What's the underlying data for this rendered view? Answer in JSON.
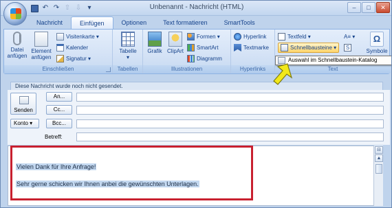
{
  "window": {
    "title": "Unbenannt - Nachricht (HTML)",
    "controls": [
      "–",
      "□",
      "✕"
    ]
  },
  "quick_access": {
    "undo": "↶",
    "redo": "↷",
    "up": "⇧",
    "down": "⇩",
    "customize": "▾"
  },
  "tabs": [
    {
      "label": "Nachricht",
      "active": false
    },
    {
      "label": "Einfügen",
      "active": true
    },
    {
      "label": "Optionen",
      "active": false
    },
    {
      "label": "Text formatieren",
      "active": false
    },
    {
      "label": "SmartTools",
      "active": false
    }
  ],
  "ribbon": {
    "einschliessen": {
      "label": "Einschließen",
      "datei_anfuegen": [
        "Datei",
        "anfügen"
      ],
      "element_anfuegen": [
        "Element",
        "anfügen"
      ],
      "visitenkarte": "Visitenkarte ▾",
      "kalender": "Kalender",
      "signatur": "Signatur ▾"
    },
    "tabellen": {
      "label": "Tabellen",
      "tabelle": [
        "Tabelle",
        "▾"
      ]
    },
    "illustrationen": {
      "label": "Illustrationen",
      "grafik": "Grafik",
      "clipart": "ClipArt",
      "formen": "Formen ▾",
      "smartart": "SmartArt",
      "diagramm": "Diagramm"
    },
    "hyperlinks": {
      "label": "Hyperlinks",
      "hyperlink": "Hyperlink",
      "textmarke": "Textmarke"
    },
    "text": {
      "label": "Text",
      "textfeld": "Textfeld ▾",
      "schnellbausteine": "Schnellbausteine ▾",
      "dropdown_a": "A≡ ▾",
      "symbol_glyph": "Ω",
      "symbole": "Symbole"
    }
  },
  "tooltip": "Auswahl im Schnellbaustein-Katalog",
  "colors": {
    "highlight_box": "#c8202f",
    "arrow": "#f2e81a"
  },
  "message": {
    "info": "Diese Nachricht wurde noch nicht gesendet.",
    "send": "Senden",
    "an": "An...",
    "cc": "Cc...",
    "konto": "Konto ▾",
    "bcc": "Bcc...",
    "betreff": "Betreff:",
    "body_lines": [
      "Vielen Dank für Ihre Anfrage!",
      "Sehr gerne schicken wir Ihnen anbei die gewünschten Unterlagen."
    ]
  }
}
